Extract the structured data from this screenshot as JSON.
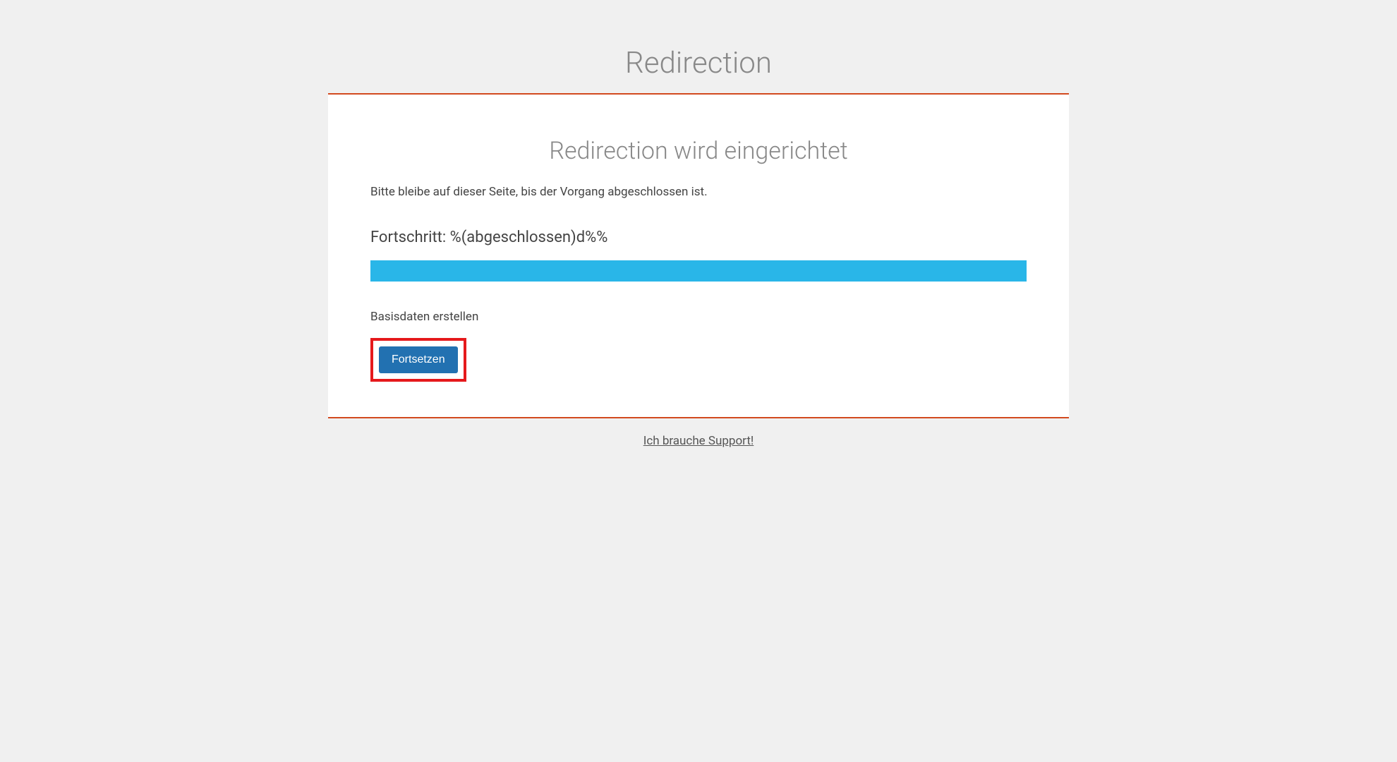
{
  "page": {
    "title": "Redirection"
  },
  "card": {
    "heading": "Redirection wird eingerichtet",
    "instruction": "Bitte bleibe auf dieser Seite, bis der Vorgang abgeschlossen ist.",
    "progress_label": "Fortschritt: %(abgeschlossen)d%%",
    "status": "Basisdaten erstellen",
    "continue_button": "Fortsetzen"
  },
  "footer": {
    "support_link": "Ich brauche Support!"
  },
  "colors": {
    "accent": "#d24a1f",
    "progress": "#29b6e8",
    "primary_button": "#2271b1",
    "highlight_border": "#e5191c"
  }
}
